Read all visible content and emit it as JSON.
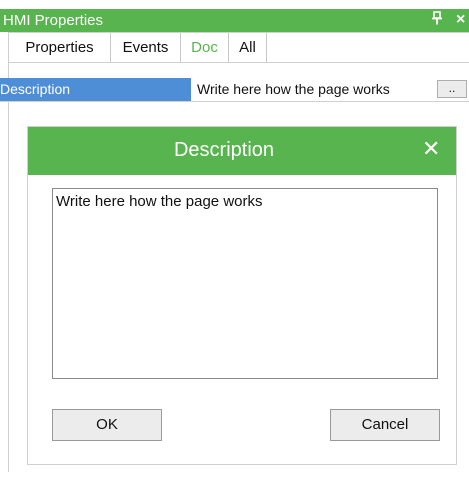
{
  "panel": {
    "title": "HMI Properties",
    "pin_icon": "Ж",
    "close_icon": "×",
    "tabs": [
      {
        "label": "Properties",
        "active": false
      },
      {
        "label": "Events",
        "active": false
      },
      {
        "label": "Doc",
        "active": true
      },
      {
        "label": "All",
        "active": false
      }
    ],
    "property": {
      "name": "Description",
      "value": "Write here how the page works",
      "button_label": ".."
    }
  },
  "dialog": {
    "title": "Description",
    "close_icon": "✕",
    "text": "Write here how the page works",
    "ok_label": "OK",
    "cancel_label": "Cancel"
  },
  "colors": {
    "accent_green": "#58b44e",
    "selection_blue": "#4d8ed6"
  }
}
